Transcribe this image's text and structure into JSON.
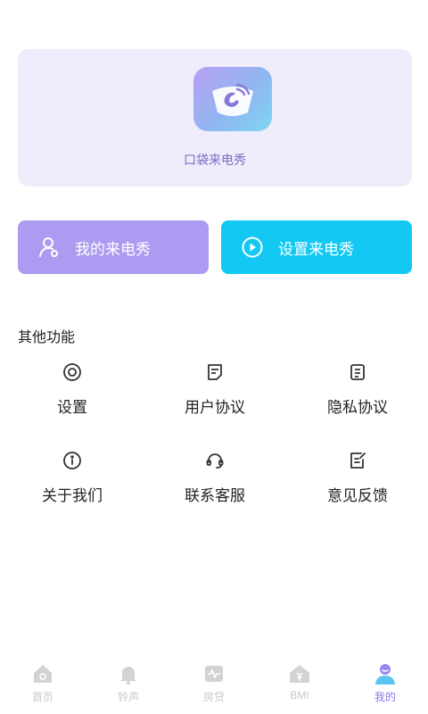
{
  "app_card": {
    "app_name": "口袋来电秀",
    "logo_icon": "phone-ring-icon"
  },
  "actions": {
    "mine_label": "我的来电秀",
    "mine_icon": "user-icon",
    "set_label": "设置来电秀",
    "set_icon": "play-circle-icon"
  },
  "section": {
    "title": "其他功能"
  },
  "features": [
    {
      "label": "设置",
      "icon": "settings-icon"
    },
    {
      "label": "用户协议",
      "icon": "document-icon"
    },
    {
      "label": "隐私协议",
      "icon": "privacy-doc-icon"
    },
    {
      "label": "关于我们",
      "icon": "info-icon"
    },
    {
      "label": "联系客服",
      "icon": "headset-icon"
    },
    {
      "label": "意见反馈",
      "icon": "feedback-icon"
    }
  ],
  "tabbar": {
    "tabs": [
      {
        "label": "首页",
        "icon": "home-icon"
      },
      {
        "label": "铃声",
        "icon": "bell-icon"
      },
      {
        "label": "房贷",
        "icon": "mortgage-icon"
      },
      {
        "label": "BMI",
        "icon": "bmi-icon"
      },
      {
        "label": "我的",
        "icon": "profile-icon"
      }
    ],
    "active_index": 4
  },
  "colors": {
    "card_bg": "#efecfc",
    "mine_button": "#ac9bf0",
    "set_button": "#13c9f4",
    "active_tab": "#8e7ae9",
    "inactive_tab": "#c8c8c8"
  }
}
